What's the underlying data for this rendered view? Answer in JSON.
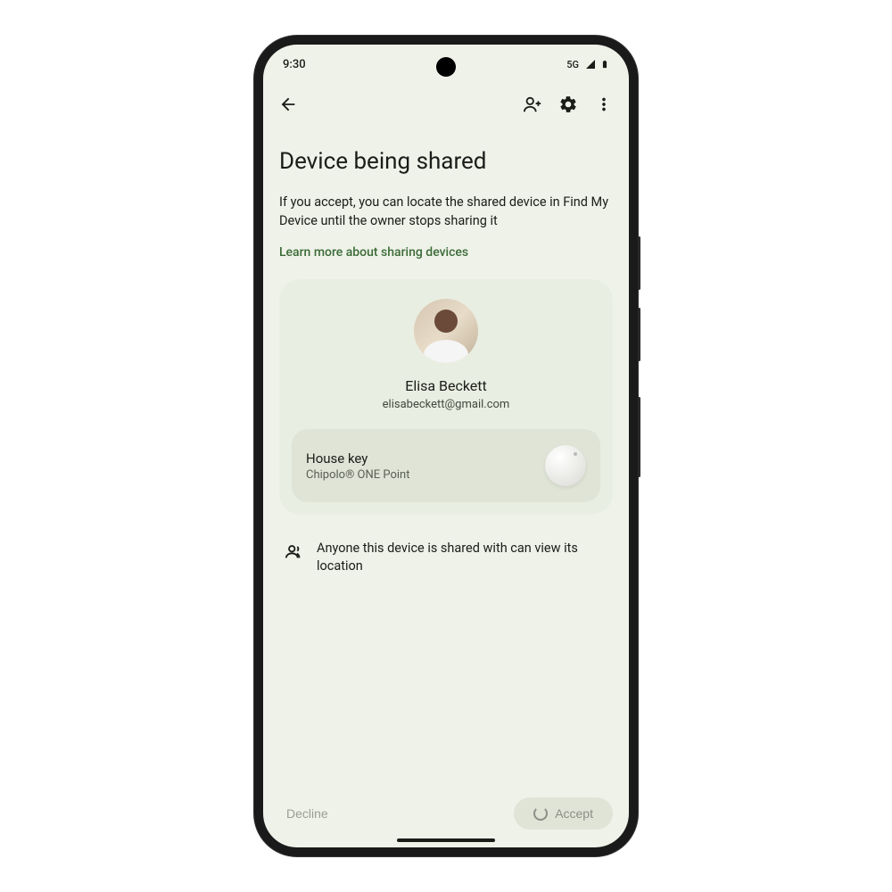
{
  "status_bar": {
    "time": "9:30",
    "network_label": "5G"
  },
  "app_bar": {
    "icons": {
      "back": "back-icon",
      "add_person": "add-person-icon",
      "settings": "gear-icon",
      "overflow": "more-vert-icon"
    }
  },
  "page": {
    "title": "Device being shared",
    "description": "If you accept, you can locate the shared device in Find My Device until the owner stops sharing it",
    "learn_more": "Learn more about sharing devices"
  },
  "sharer": {
    "name": "Elisa Beckett",
    "email": "elisabeckett@gmail.com"
  },
  "device": {
    "name": "House key",
    "model": "Chipolo® ONE Point"
  },
  "notice": "Anyone this device is shared with can view its location",
  "actions": {
    "decline": "Decline",
    "accept": "Accept"
  },
  "colors": {
    "background": "#eff2e9",
    "card": "#e9eee2",
    "device_row": "#dfe4d7",
    "link": "#3b6b37",
    "text_primary": "#1b1c18"
  }
}
